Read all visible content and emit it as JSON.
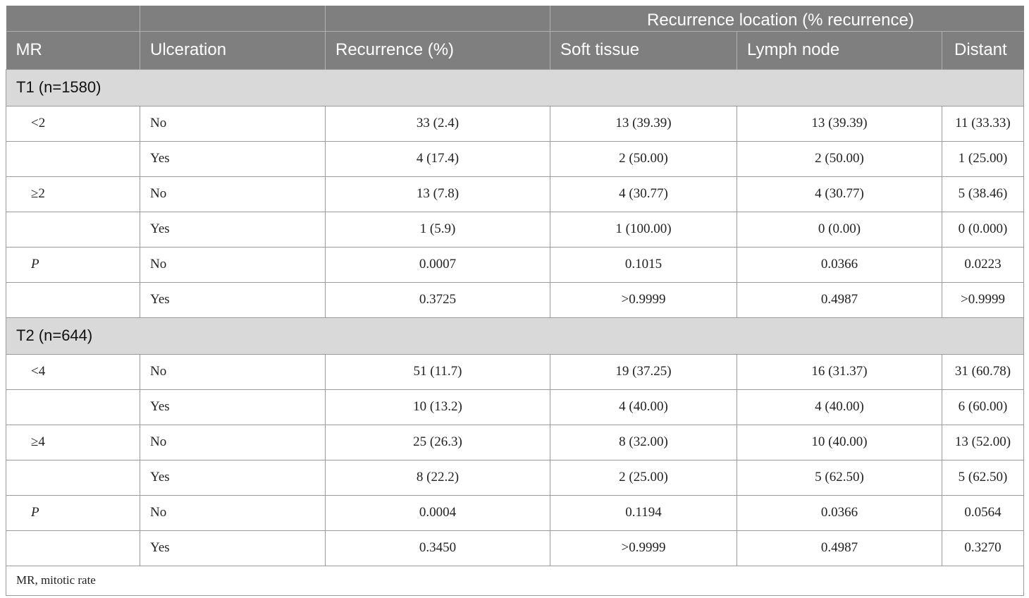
{
  "header": {
    "group_label": "Recurrence location (% recurrence)",
    "columns": [
      "MR",
      "Ulceration",
      "Recurrence (%)",
      "Soft tissue",
      "Lymph node",
      "Distant"
    ]
  },
  "sections": [
    {
      "title": "T1 (n=1580)",
      "rows": [
        {
          "mr": "<2",
          "ulceration": "No",
          "recurrence": "33 (2.4)",
          "soft_tissue": "13 (39.39)",
          "lymph_node": "13 (39.39)",
          "distant": "11 (33.33)"
        },
        {
          "mr": "",
          "ulceration": "Yes",
          "recurrence": "4 (17.4)",
          "soft_tissue": "2 (50.00)",
          "lymph_node": "2 (50.00)",
          "distant": "1 (25.00)"
        },
        {
          "mr": "≥2",
          "ulceration": "No",
          "recurrence": "13 (7.8)",
          "soft_tissue": "4 (30.77)",
          "lymph_node": "4 (30.77)",
          "distant": "5 (38.46)"
        },
        {
          "mr": "",
          "ulceration": "Yes",
          "recurrence": "1 (5.9)",
          "soft_tissue": "1 (100.00)",
          "lymph_node": "0 (0.00)",
          "distant": "0 (0.000)"
        },
        {
          "mr": "P",
          "ulceration": "No",
          "recurrence": "0.0007",
          "soft_tissue": "0.1015",
          "lymph_node": "0.0366",
          "distant": "0.0223"
        },
        {
          "mr": "",
          "ulceration": "Yes",
          "recurrence": "0.3725",
          "soft_tissue": ">0.9999",
          "lymph_node": "0.4987",
          "distant": ">0.9999"
        }
      ]
    },
    {
      "title": "T2 (n=644)",
      "rows": [
        {
          "mr": "<4",
          "ulceration": "No",
          "recurrence": "51 (11.7)",
          "soft_tissue": "19 (37.25)",
          "lymph_node": "16 (31.37)",
          "distant": "31 (60.78)"
        },
        {
          "mr": "",
          "ulceration": "Yes",
          "recurrence": "10 (13.2)",
          "soft_tissue": "4 (40.00)",
          "lymph_node": "4 (40.00)",
          "distant": "6 (60.00)"
        },
        {
          "mr": "≥4",
          "ulceration": "No",
          "recurrence": "25 (26.3)",
          "soft_tissue": "8 (32.00)",
          "lymph_node": "10 (40.00)",
          "distant": "13 (52.00)"
        },
        {
          "mr": "",
          "ulceration": "Yes",
          "recurrence": "8 (22.2)",
          "soft_tissue": "2 (25.00)",
          "lymph_node": "5 (62.50)",
          "distant": "5 (62.50)"
        },
        {
          "mr": "P",
          "ulceration": "No",
          "recurrence": "0.0004",
          "soft_tissue": "0.1194",
          "lymph_node": "0.0366",
          "distant": "0.0564"
        },
        {
          "mr": "",
          "ulceration": "Yes",
          "recurrence": "0.3450",
          "soft_tissue": ">0.9999",
          "lymph_node": "0.4987",
          "distant": "0.3270"
        }
      ]
    }
  ],
  "footnote": "MR, mitotic rate"
}
